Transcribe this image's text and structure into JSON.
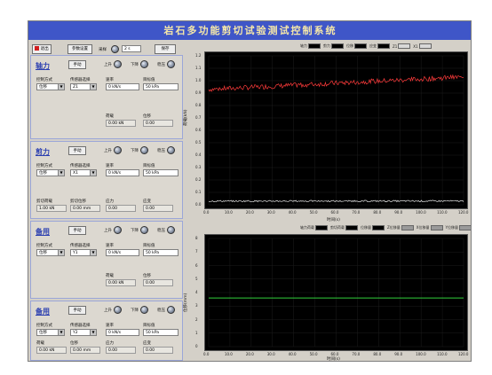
{
  "app": {
    "title": "岩石多功能剪切试验测试控制系统"
  },
  "toolbar": {
    "stop_label": "退出",
    "param_label": "参数设置",
    "freq_label": "采样",
    "freq_value": "2 s",
    "save_label": "保存"
  },
  "panels": [
    {
      "title": "轴力",
      "manual_label": "手动",
      "indicators": [
        "上升",
        "下降",
        "稳压"
      ],
      "mode_label": "控制方式",
      "mode_value": "位移",
      "sensor_label": "传感器选择",
      "sensor_value": "Z1",
      "rate_label": "速率",
      "rate_value": "0 kN/s",
      "target_label": "目标值",
      "target_value": "50 kPa",
      "disp1_label": "荷载",
      "disp1_value": "0.00 kN",
      "disp2_label": "位移",
      "disp2_value": "0.00"
    },
    {
      "title": "剪力",
      "manual_label": "手动",
      "indicators": [
        "上升",
        "下降",
        "稳压"
      ],
      "mode_label": "控制方式",
      "mode_value": "位移",
      "sensor_label": "传感器选择",
      "sensor_value": "X1",
      "rate_label": "速率",
      "rate_value": "0 kN/s",
      "target_label": "目标值",
      "target_value": "50 kPa",
      "disp1_label": "剪切荷载",
      "disp1_value": "1.00 kN",
      "disp2_label": "剪切位移",
      "disp2_value": "0.00 mm",
      "disp3_label": "应力",
      "disp3_value": "0.00",
      "disp4_label": "应变",
      "disp4_value": "0.00"
    },
    {
      "title": "备用",
      "manual_label": "手动",
      "indicators": [
        "上升",
        "下降",
        "稳压"
      ],
      "mode_label": "控制方式",
      "mode_value": "位移",
      "sensor_label": "传感器选择",
      "sensor_value": "Y1",
      "rate_label": "速率",
      "rate_value": "0 kN/s",
      "target_label": "目标值",
      "target_value": "50 kPa",
      "disp1_label": "荷载",
      "disp1_value": "0.00 kN",
      "disp2_label": "位移",
      "disp2_value": "0.00"
    },
    {
      "title": "备用",
      "manual_label": "手动",
      "indicators": [
        "上升",
        "下降",
        "稳压"
      ],
      "mode_label": "控制方式",
      "mode_value": "位移",
      "sensor_label": "传感器选择",
      "sensor_value": "Y2",
      "rate_label": "速率",
      "rate_value": "0 kN/s",
      "target_label": "目标值",
      "target_value": "50 kPa",
      "disp1_label": "荷载",
      "disp1_value": "0.00 kN",
      "disp2_label": "位移",
      "disp2_value": "0.00 mm",
      "disp3_label": "应力",
      "disp3_value": "0.00",
      "disp4_label": "应变",
      "disp4_value": "0.00"
    }
  ],
  "legend_top": [
    "轴力",
    "剪力",
    "位移",
    "应变",
    "Z1",
    "X1"
  ],
  "legend_bottom": [
    "轴力荷载",
    "剪切荷载",
    "位移量",
    "Z位移量",
    "X位移量",
    "Y位移量"
  ],
  "colors": {
    "title_bg": "#3f56c8",
    "title_fg": "#f5e7a8",
    "red": "#ff3b3b",
    "white": "#e8e8e8",
    "green": "#32d13c"
  },
  "chart_data": [
    {
      "type": "line",
      "xlabel": "时间(s)",
      "ylabel": "荷载(kN)",
      "x_ticks": [
        "0.0",
        "10.0",
        "20.0",
        "30.0",
        "40.0",
        "50.0",
        "60.0",
        "70.0",
        "80.0",
        "90.0",
        "100.0",
        "110.0",
        "120.0"
      ],
      "y_ticks": [
        "0.0",
        "0.1",
        "0.2",
        "0.3",
        "0.4",
        "0.5",
        "0.6",
        "0.7",
        "0.8",
        "0.9",
        "1.0",
        "1.1",
        "1.2"
      ],
      "xlim": [
        0,
        120
      ],
      "ylim": [
        0,
        1.2
      ],
      "series": [
        {
          "name": "轴力",
          "color": "#ff3b3b",
          "trend": [
            [
              0,
              0.93
            ],
            [
              120,
              1.03
            ]
          ],
          "noise": 0.02
        },
        {
          "name": "剪力",
          "color": "#e8e8e8",
          "trend": [
            [
              0,
              0.03
            ],
            [
              120,
              0.03
            ]
          ],
          "noise": 0.006
        }
      ]
    },
    {
      "type": "line",
      "xlabel": "时间(s)",
      "ylabel": "位移(mm)",
      "x_ticks": [
        "0.0",
        "10.0",
        "20.0",
        "30.0",
        "40.0",
        "50.0",
        "60.0",
        "70.0",
        "80.0",
        "90.0",
        "100.0",
        "110.0",
        "120.0"
      ],
      "y_ticks": [
        "0",
        "1",
        "2",
        "3",
        "4",
        "5",
        "6",
        "7",
        "8"
      ],
      "xlim": [
        0,
        120
      ],
      "ylim": [
        0,
        8
      ],
      "series": [
        {
          "name": "位移",
          "color": "#32d13c",
          "trend": [
            [
              0,
              3.6
            ],
            [
              120,
              3.6
            ]
          ],
          "noise": 0.0
        }
      ]
    }
  ]
}
